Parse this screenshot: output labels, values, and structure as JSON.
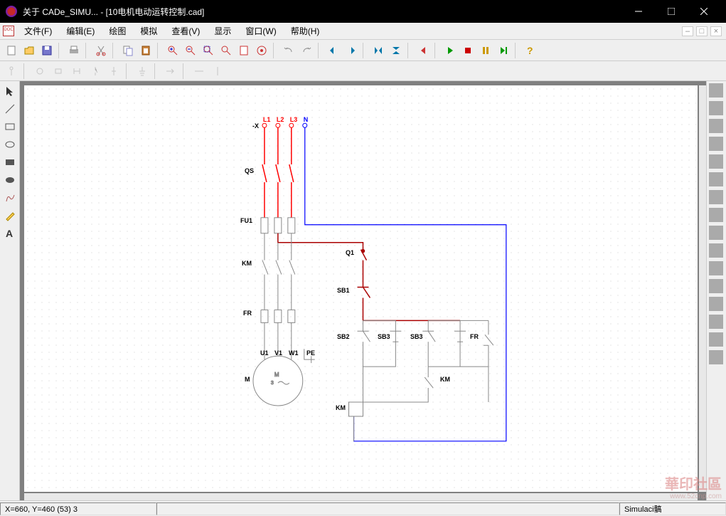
{
  "window": {
    "title": "关于 CADe_SIMU... - [10电机电动运转控制.cad]"
  },
  "menu": {
    "file": "文件(F)",
    "edit": "编辑(E)",
    "draw": "绘图",
    "sim": "模拟",
    "view": "查看(V)",
    "display": "显示",
    "window": "窗口(W)",
    "help": "帮助(H)"
  },
  "status": {
    "coords": "X=660, Y=460 (53) 3",
    "mode": "Simulaci髇"
  },
  "watermark": {
    "main": "華印社區",
    "url": "www.52cnp.com"
  },
  "labels": {
    "L1": "L1",
    "L2": "L2",
    "L3": "L3",
    "N": "N",
    "X": "-X",
    "QS": "QS",
    "FU1": "FU1",
    "KM": "KM",
    "FR": "FR",
    "U1": "U1",
    "V1": "V1",
    "W1": "W1",
    "PE": "PE",
    "M": "M",
    "M3": "3",
    "Msym": "~",
    "Q1": "Q1",
    "SB1": "SB1",
    "SB2": "SB2",
    "SB3": "SB3",
    "FRr": "FR",
    "KMr": "KM",
    "KMc": "KM"
  }
}
